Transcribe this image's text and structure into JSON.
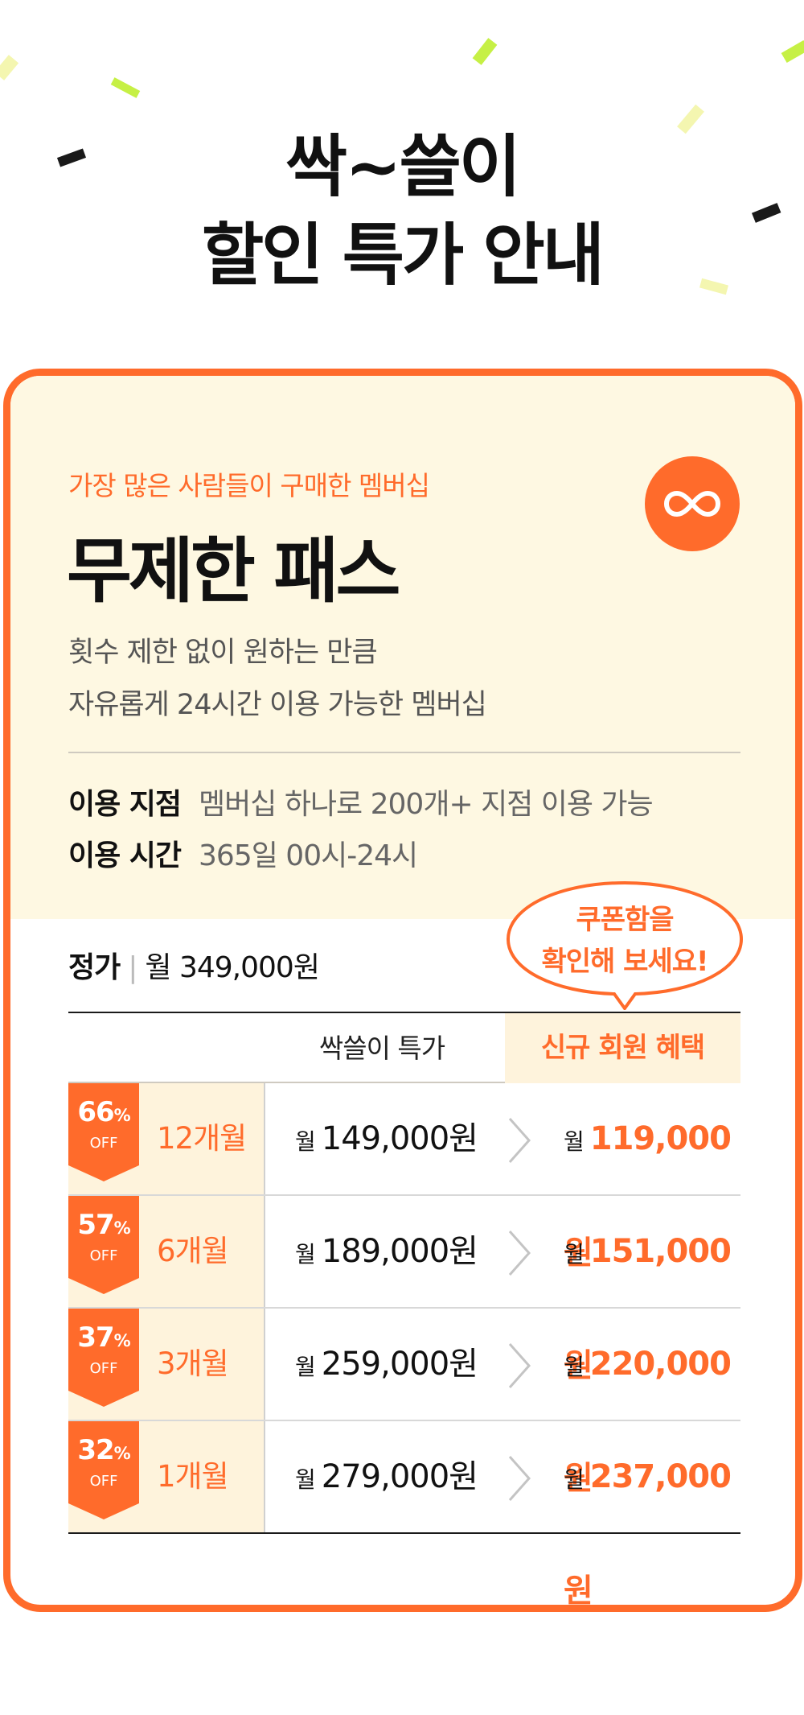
{
  "header": {
    "title_line1": "싹~쓸이",
    "title_line2": "할인 특가 안내"
  },
  "colors": {
    "accent": "#ff6b2b",
    "card_bg": "#fef8e2",
    "highlight": "#e6f99a",
    "confetti_lime": "#c6f045",
    "confetti_dark": "#1a1a1a"
  },
  "plan": {
    "subtitle": "가장 많은 사람들이 구매한 멤버십",
    "name": "무제한 패스",
    "icon": "infinity-icon",
    "desc_line1": "횟수 제한 없이 원하는 만큼",
    "desc_line2": "자유롭게 24시간 이용 가능한 멤버십",
    "info": [
      {
        "label": "이용 지점",
        "value": "멤버십 하나로 200개+ 지점 이용 가능"
      },
      {
        "label": "이용 시간",
        "value": "365일 00시-24시"
      }
    ]
  },
  "regular_price": {
    "label": "정가",
    "separator": "|",
    "value": "월 349,000원"
  },
  "bubble": {
    "line1": "쿠폰함을",
    "line2": "확인해 보세요!"
  },
  "table": {
    "header_sale": "싹쓸이 특가",
    "header_new": "신규 회원 혜택",
    "month_prefix": "월",
    "rows": [
      {
        "pct": "66",
        "pct_unit": "%",
        "off": "OFF",
        "months": "12개월",
        "sale": "149,000원",
        "new": "119,000원"
      },
      {
        "pct": "57",
        "pct_unit": "%",
        "off": "OFF",
        "months": "6개월",
        "sale": "189,000원",
        "new": "151,000원"
      },
      {
        "pct": "37",
        "pct_unit": "%",
        "off": "OFF",
        "months": "3개월",
        "sale": "259,000원",
        "new": "220,000원"
      },
      {
        "pct": "32",
        "pct_unit": "%",
        "off": "OFF",
        "months": "1개월",
        "sale": "279,000원",
        "new": "237,000원"
      }
    ]
  }
}
